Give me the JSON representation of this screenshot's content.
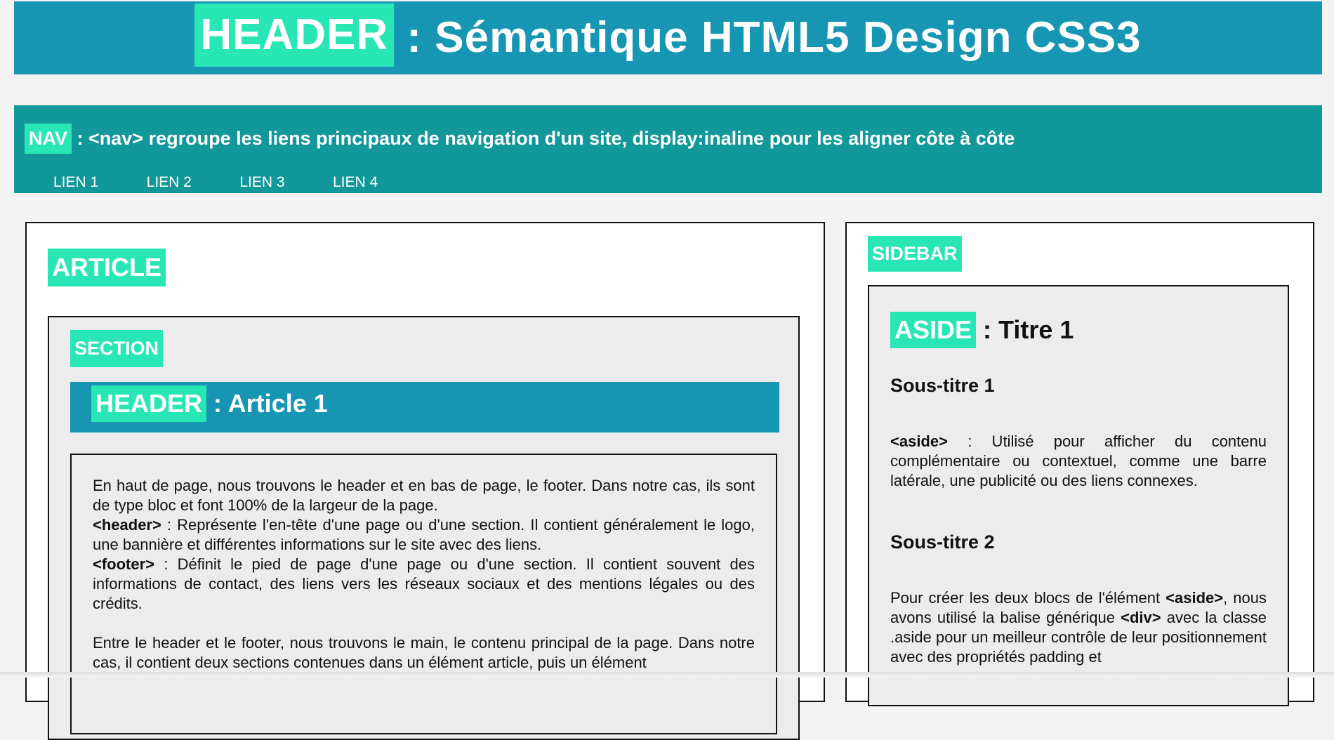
{
  "header": {
    "tag": "HEADER",
    "title": " : Sémantique HTML5 Design CSS3"
  },
  "nav": {
    "tag": "NAV",
    "desc_prefix": " : ",
    "desc_code": "<nav>",
    "desc_rest": " regroupe les liens principaux de navigation d'un site, display:inaline pour les aligner côte à côte",
    "links": [
      "LIEN 1",
      "LIEN 2",
      "LIEN 3",
      "LIEN 4"
    ]
  },
  "article": {
    "title": "ARTICLE",
    "section": {
      "title": "SECTION",
      "header_tag": "HEADER",
      "header_title": " : Article 1",
      "p1": "En haut de page, nous trouvons le header et en bas de page, le footer. Dans notre cas, ils sont de type bloc et font 100% de la largeur de la page.",
      "header_code": "<header>",
      "header_text": " : Représente l'en-tête d'une page ou d'une section. Il contient généralement le logo, une bannière et différentes informations sur le site avec des liens.",
      "footer_code": "<footer>",
      "footer_text": " : Définit le pied de page d'une page ou d'une section. Il contient souvent des informations de contact, des liens vers les réseaux sociaux et des mentions légales ou des crédits.",
      "p2": "Entre le header et le footer, nous trouvons le main, le contenu principal de la page. Dans notre cas, il contient deux sections contenues dans un élément article, puis un élément"
    }
  },
  "sidebar": {
    "title": "SIDEBAR",
    "aside": {
      "tag": "ASIDE",
      "title": " : Titre 1",
      "subtitle1": "Sous-titre 1",
      "p1_code": "<aside>",
      "p1_text": " : Utilisé pour afficher du contenu complémentaire ou contextuel, comme une barre latérale, une publicité ou des liens connexes.",
      "subtitle2": "Sous-titre 2",
      "p2_a": "Pour créer les deux blocs de l'élément ",
      "p2_code1": "<aside>",
      "p2_b": ", nous avons utilisé la balise générique ",
      "p2_code2": "<div>",
      "p2_c": " avec la classe .aside pour un meilleur contrôle de leur positionnement avec des propriétés padding et"
    }
  },
  "colors": {
    "header_bg": "#1696b2",
    "nav_bg": "#12979a",
    "tag_bg": "#29e6b5",
    "page_bg": "#f3f3f3"
  }
}
